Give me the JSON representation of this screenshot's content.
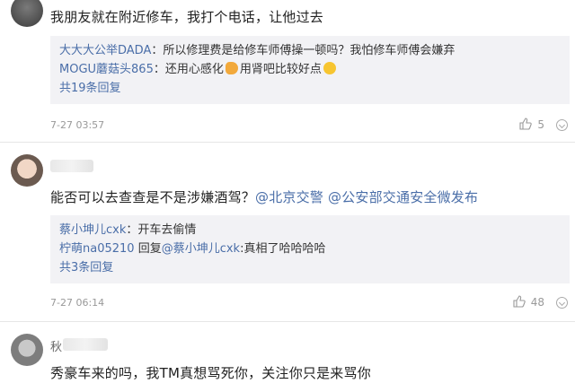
{
  "comments": [
    {
      "text": "我朋友就在附近修车，我打个电话，让他过去",
      "replies": [
        {
          "user": "大大大公举DADA",
          "text": "：所以修理费是给修车师傅操一顿吗？我怕修车师傅会嫌弃"
        },
        {
          "user": "MOGU蘑菇头865",
          "text": "：还用心感化",
          "text2": "用肾吧比较好点"
        }
      ],
      "more": "共19条回复",
      "time": "7-27 03:57",
      "likes": "5"
    },
    {
      "text_prefix": "能否可以去查查是不是涉嫌酒驾？",
      "mentions": [
        "@北京交警",
        "@公安部交通安全微发布"
      ],
      "replies": [
        {
          "user": "蔡小坤儿cxk",
          "text": "：开车去偷情"
        },
        {
          "user": "柠萌na05210",
          "text": " 回复",
          "mention": "@蔡小坤儿cxk",
          "text2": ":真相了哈哈哈哈"
        }
      ],
      "more": "共3条回复",
      "time": "7-27 06:14",
      "likes": "48"
    },
    {
      "username_partial": "秋",
      "text": "秀豪车来的吗，我TM真想骂死你，关注你只是来骂你"
    }
  ],
  "colors": {
    "link": "#4a6ea8",
    "reply_bg": "#f2f2f5",
    "meta": "#999999"
  }
}
